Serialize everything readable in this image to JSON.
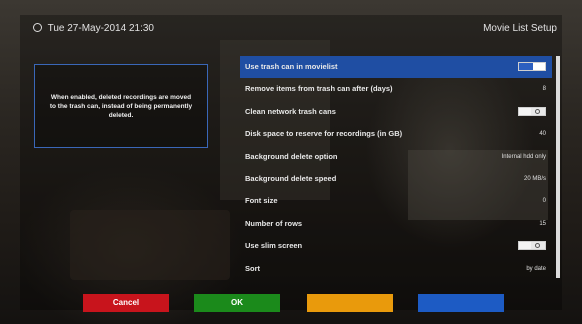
{
  "header": {
    "datetime": "Tue 27-May-2014 21:30",
    "title": "Movie List Setup"
  },
  "help_text": "When enabled, deleted recordings are moved to the trash can, instead of being permanently deleted.",
  "settings": [
    {
      "label": "Use trash can in movielist",
      "control": "toggle",
      "state": "on",
      "selected": true
    },
    {
      "label": "Remove items from trash can after (days)",
      "value": "8"
    },
    {
      "label": "Clean network trash cans",
      "control": "toggle",
      "state": "off"
    },
    {
      "label": "Disk space to reserve for recordings (in GB)",
      "value": "40"
    },
    {
      "label": "Background delete option",
      "value": "Internal hdd only"
    },
    {
      "label": "Background delete speed",
      "value": "20 MB/s"
    },
    {
      "label": "Font size",
      "value": "0"
    },
    {
      "label": "Number of rows",
      "value": "15"
    },
    {
      "label": "Use slim screen",
      "control": "toggle",
      "state": "off"
    },
    {
      "label": "Sort",
      "value": "by date"
    }
  ],
  "buttons": {
    "red": "Cancel",
    "green": "OK",
    "yellow": "",
    "blue": ""
  },
  "colors": {
    "selection": "#1f4ea3",
    "red": "#c8141c",
    "green": "#1b8a1b",
    "yellow": "#e99a0c",
    "blue": "#1d5bc4"
  }
}
